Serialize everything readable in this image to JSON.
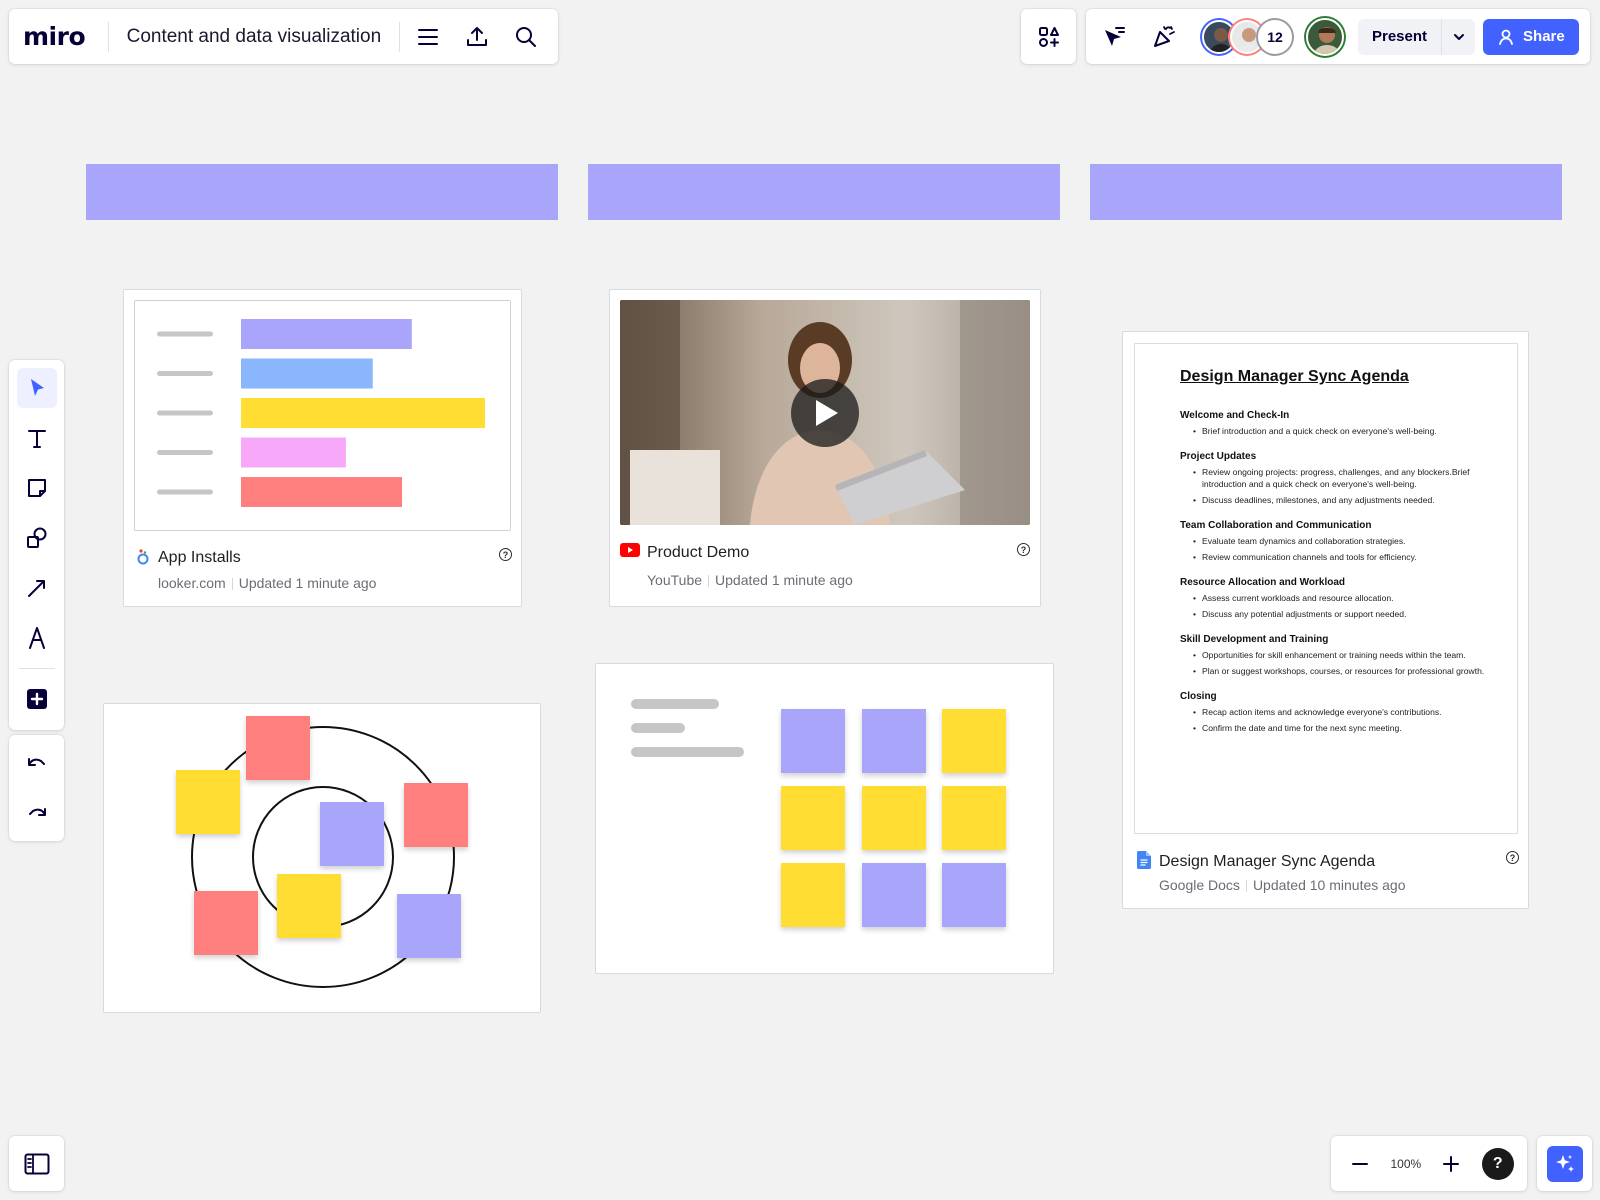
{
  "header": {
    "logo": "miro",
    "board_title": "Content and data visualization",
    "menu_icon": "hamburger-menu-icon",
    "export_icon": "upload-icon",
    "search_icon": "search-icon"
  },
  "collab": {
    "apps_icon": "shapes-plus-icon",
    "follow_icon": "cursor-arrow-icon",
    "reactions_icon": "party-popper-icon",
    "extra_collaborators": "12",
    "present_label": "Present",
    "share_label": "Share",
    "share_color": "#4262ff"
  },
  "toolbar": {
    "tools": [
      "select-arrow-icon",
      "text-icon",
      "sticky-note-icon",
      "shapes-icon",
      "connection-line-icon",
      "pen-icon",
      "add-icon"
    ],
    "undo_icon": "undo-icon",
    "redo_icon": "redo-icon"
  },
  "frames": {
    "header_color": "#a9a5fb"
  },
  "app_installs_card": {
    "title": "App Installs",
    "source": "looker.com",
    "updated": "Updated 1 minute ago",
    "chart_data": {
      "type": "bar",
      "orientation": "horizontal",
      "categories": [
        "",
        "",
        "",
        "",
        ""
      ],
      "values": [
        70,
        54,
        100,
        43,
        66
      ],
      "colors": [
        "#a9a5fb",
        "#8ab6fb",
        "#ffdd33",
        "#f8a8f8",
        "#ff7f7f"
      ],
      "title": "",
      "xlabel": "",
      "ylabel": "",
      "xlim": [
        0,
        100
      ],
      "grid": false,
      "legend": "none"
    }
  },
  "product_demo_card": {
    "title": "Product Demo",
    "source": "YouTube",
    "updated": "Updated 1 minute ago",
    "play_icon": "play-icon"
  },
  "agenda_card": {
    "title": "Design Manager Sync Agenda",
    "source": "Google Docs",
    "updated": "Updated 10 minutes ago",
    "doc": {
      "heading": "Design Manager Sync Agenda",
      "sections": [
        {
          "title": "Welcome and Check-In",
          "bullets": [
            "Brief introduction and a quick check on everyone's well-being."
          ]
        },
        {
          "title": "Project Updates",
          "bullets": [
            "Review ongoing projects: progress, challenges, and any blockers.Brief introduction and a quick check on everyone's well-being.",
            "Discuss deadlines, milestones, and any adjustments needed."
          ]
        },
        {
          "title": "Team Collaboration and Communication",
          "bullets": [
            "Evaluate team dynamics and collaboration strategies.",
            "Review communication channels and tools for efficiency."
          ]
        },
        {
          "title": "Resource Allocation and Workload",
          "bullets": [
            "Assess current workloads and resource allocation.",
            "Discuss any potential adjustments or support needed."
          ]
        },
        {
          "title": "Skill Development and Training",
          "bullets": [
            "Opportunities for skill enhancement or training needs within the team.",
            "Plan or suggest workshops, courses, or resources for professional growth."
          ]
        },
        {
          "title": "Closing",
          "bullets": [
            "Recap action items and acknowledge everyone's contributions.",
            "Confirm the date and time for the next sync meeting."
          ]
        }
      ]
    }
  },
  "sticky_colors": {
    "purple": "#a9a5fb",
    "yellow": "#ffdd33",
    "red": "#ff7f7f"
  },
  "bottom": {
    "sidebar_icon": "panel-toggle-icon",
    "zoom_level": "100%",
    "help_label": "?",
    "ai_icon": "sparkle-icon"
  }
}
